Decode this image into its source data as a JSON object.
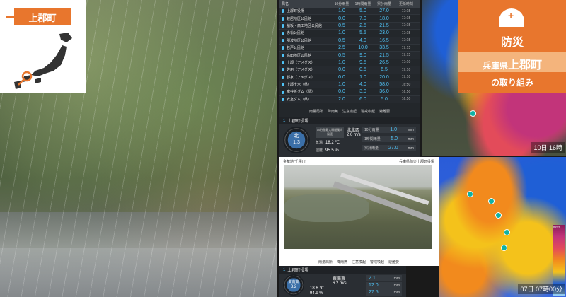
{
  "town": {
    "label": "上郡町"
  },
  "badge": {
    "title": "防災",
    "place_prefix": "兵庫県",
    "place_town": "上郡町",
    "subtitle": "の取り組み"
  },
  "rain_table": {
    "headers": [
      "局名",
      "10分雨量",
      "1時間雨量",
      "累計雨量",
      "更新時刻"
    ],
    "rows": [
      [
        "上郡町役場",
        "1.0",
        "5.0",
        "27.0",
        "17:15"
      ],
      [
        "鞍居地区公民館",
        "0.0",
        "7.0",
        "18.0",
        "17:15"
      ],
      [
        "船坂・高田地区公民館",
        "0.5",
        "2.5",
        "21.5",
        "17:15"
      ],
      [
        "赤松公民館",
        "1.0",
        "5.5",
        "23.0",
        "17:15"
      ],
      [
        "那波地区公民館",
        "0.5",
        "4.0",
        "16.5",
        "17:15"
      ],
      [
        "若戸公民館",
        "2.5",
        "10.0",
        "33.5",
        "17:15"
      ],
      [
        "高田地区公民館",
        "0.5",
        "9.0",
        "21.5",
        "17:15"
      ],
      [
        "上郡（アメダス）",
        "1.0",
        "9.5",
        "26.5",
        "17:10"
      ],
      [
        "佐用（アメダス）",
        "0.0",
        "0.5",
        "6.5",
        "17:10"
      ],
      [
        "郡家（アメダス）",
        "0.0",
        "1.0",
        "20.0",
        "17:10"
      ],
      [
        "上郡土木（県）",
        "1.0",
        "4.0",
        "58.0",
        "16:50"
      ],
      [
        "富谷坂ダム（県）",
        "0.0",
        "3.0",
        "36.0",
        "16:50"
      ],
      [
        "安室ダム（県）",
        "2.0",
        "6.0",
        "5.0",
        "16:50"
      ]
    ],
    "legend": [
      "雨量局所",
      "降雨無",
      "注意喚起",
      "警戒喚起",
      "避難要"
    ]
  },
  "station1": {
    "title": "上郡町役場",
    "direction": "北",
    "speed": "1.3",
    "wind_label": "10分間最大瞬間風向風速",
    "wind_value": "北北西",
    "wind_speed": "2.0 m/s",
    "temp_label": "気温",
    "temp": "18.2 ℃",
    "hum_label": "湿度",
    "hum": "95.5 %",
    "rain10_label": "10分雨量",
    "rain10": "1.0",
    "rain60_label": "1時間雨量",
    "rain60": "5.0",
    "raintot_label": "累計雨量",
    "raintot": "27.0",
    "unit": "mm"
  },
  "camera": {
    "title": "金華地(千種川)",
    "subtitle": "兵庫県防災上郡町役場",
    "legend": [
      "雨量局所",
      "降雨無",
      "注意喚起",
      "警戒喚起",
      "避難要"
    ]
  },
  "station2": {
    "title": "上郡町役場",
    "direction": "東南東",
    "speed": "3.2",
    "wind_value": "東南東",
    "wind_speed": "6.2 m/s",
    "temp": "18.6 ℃",
    "hum": "94.9 %",
    "rain10": "2.1",
    "rain60": "12.0",
    "raintot": "27.5"
  },
  "maps": {
    "top_time": "10日 16時",
    "bottom_time": "07日 07時00分",
    "scale_unit": "mm/h",
    "pin_numbers": [
      "1",
      "3",
      "5",
      "4",
      "2",
      "6"
    ]
  }
}
